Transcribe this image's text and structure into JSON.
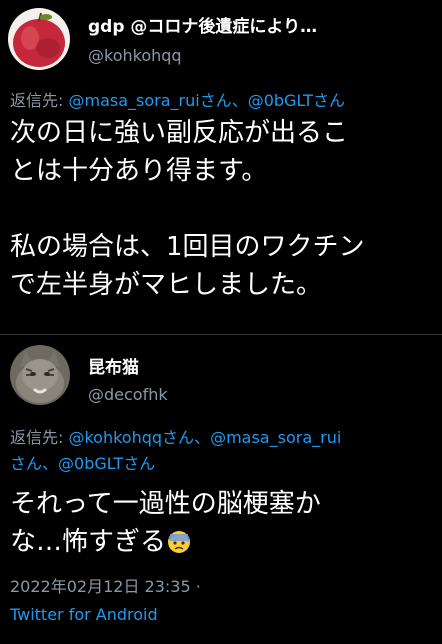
{
  "tweet1": {
    "display_name": "gdp @コロナ後遺症により…",
    "handle": "@kohkohqq",
    "reply_prefix": "返信先: ",
    "mentions": [
      "@masa_sora_ruiさん",
      "、",
      "@0bGLTさん"
    ],
    "body_line1": "次の日に強い副反応が出るこ",
    "body_line2": "とは十分あり得ます。",
    "body_line3": "私の場合は、1回目のワクチン",
    "body_line4": "で左半身がマヒしました。"
  },
  "tweet2": {
    "display_name": "昆布猫",
    "handle": "@decofhk",
    "reply_prefix": "返信先: ",
    "reply_line1_mentions": [
      "@kohkohqqさん",
      "、",
      "@masa_sora_rui"
    ],
    "reply_line2_mentions": [
      "さん",
      "、",
      "@0bGLTさん"
    ],
    "body_line1": "それって一過性の脳梗塞か",
    "body_line2": "な…怖すぎる",
    "emoji": "anxious-face-with-sweat",
    "timestamp": "2022年02月12日 23:35",
    "separator": " ·",
    "source": "Twitter for Android"
  }
}
